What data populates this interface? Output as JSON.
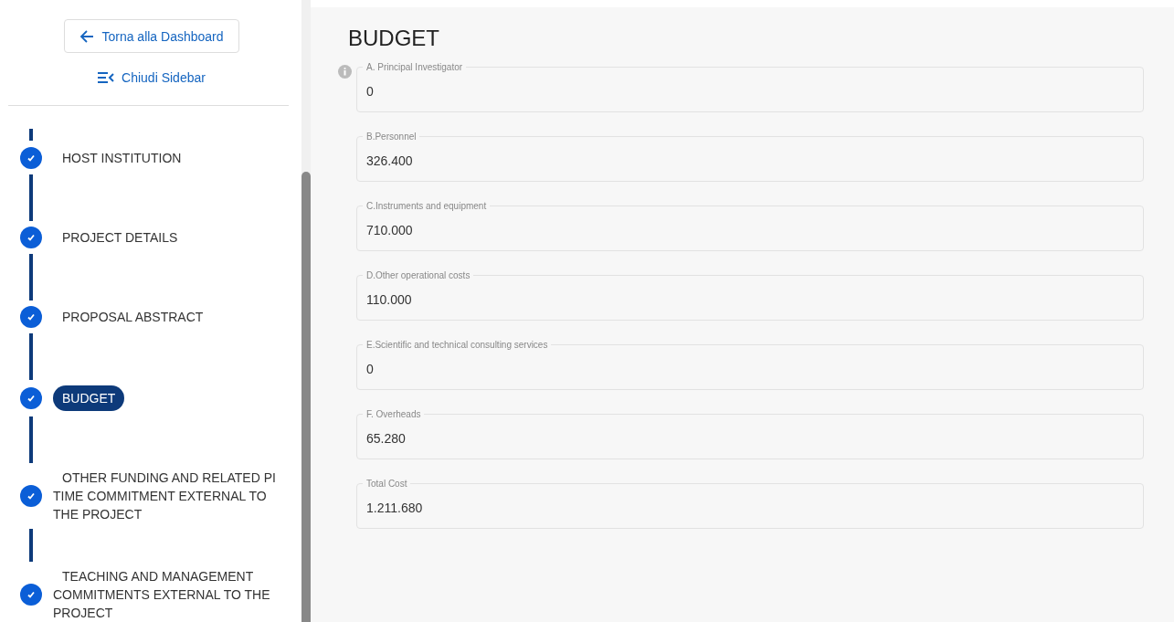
{
  "sidebar": {
    "back_button": {
      "label": "Torna alla Dashboard"
    },
    "close_sidebar": {
      "label": "Chiudi Sidebar"
    },
    "steps": [
      {
        "label": "HOST INSTITUTION",
        "completed": true,
        "selected": false
      },
      {
        "label": "PROJECT DETAILS",
        "completed": true,
        "selected": false
      },
      {
        "label": "PROPOSAL ABSTRACT",
        "completed": true,
        "selected": false
      },
      {
        "label": "BUDGET",
        "completed": true,
        "selected": true
      },
      {
        "label": "OTHER FUNDING AND RELATED PI TIME COMMITMENT EXTERNAL TO THE PROJECT",
        "completed": true,
        "selected": false
      },
      {
        "label": "TEACHING AND MANAGEMENT COMMITMENTS EXTERNAL TO THE PROJECT",
        "completed": true,
        "selected": false
      }
    ]
  },
  "main": {
    "title": "BUDGET",
    "fields": [
      {
        "label": "A. Principal Investigator",
        "value": "0",
        "info": true
      },
      {
        "label": "B.Personnel",
        "value": "326.400",
        "info": false
      },
      {
        "label": "C.Instruments and equipment",
        "value": "710.000",
        "info": false
      },
      {
        "label": "D.Other operational costs",
        "value": "110.000",
        "info": false
      },
      {
        "label": "E.Scientific and technical consulting services",
        "value": "0",
        "info": false
      },
      {
        "label": "F. Overheads",
        "value": "65.280",
        "info": false
      },
      {
        "label": "Total Cost",
        "value": "1.211.680",
        "info": false
      }
    ]
  }
}
